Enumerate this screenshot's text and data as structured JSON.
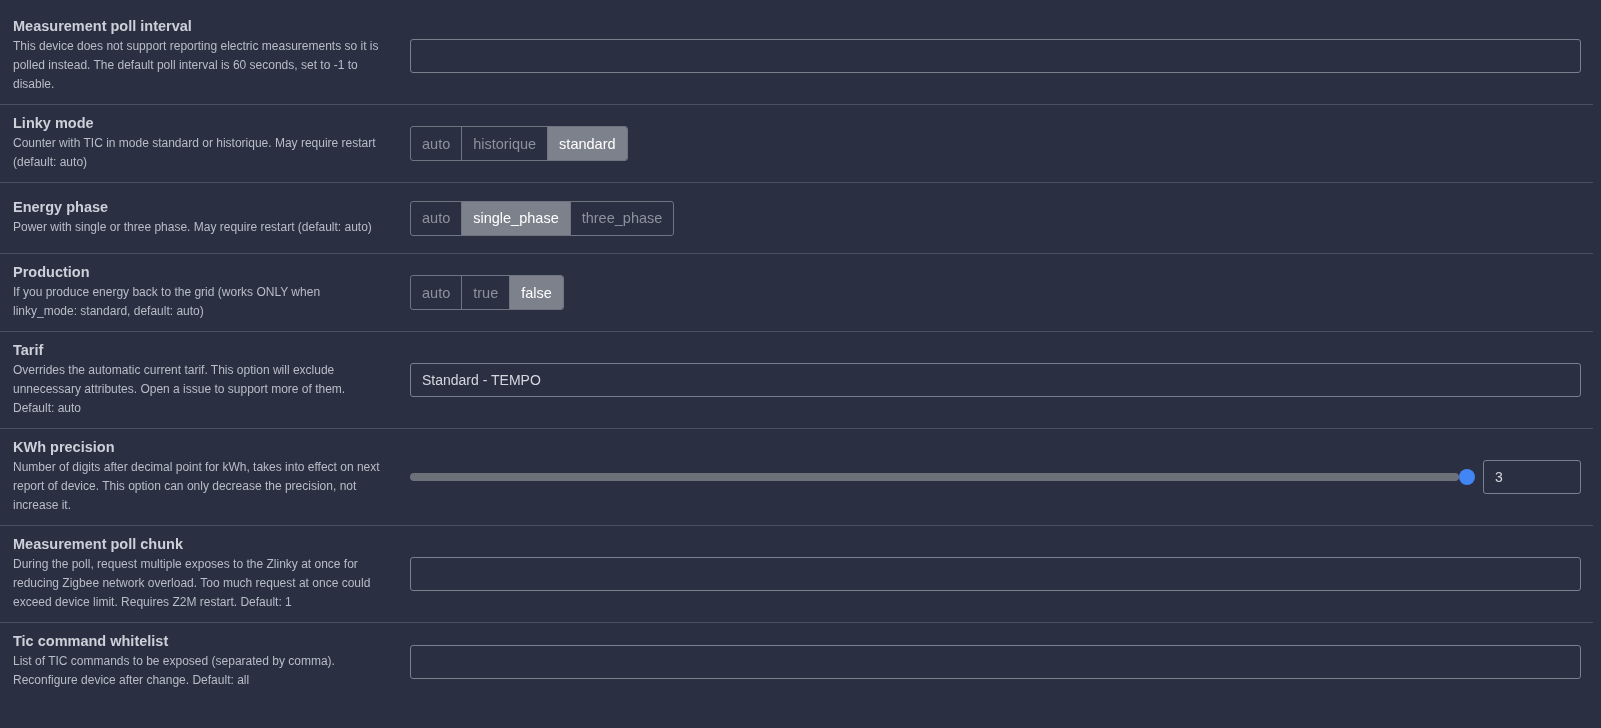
{
  "settings": [
    {
      "title": "Measurement poll interval",
      "description": "This device does not support reporting electric measurements so it is polled instead. The default poll interval is 60 seconds, set to -1 to disable.",
      "kind": "text"
    },
    {
      "title": "Linky mode",
      "description": "Counter with TIC in mode standard or historique. May require restart (default: auto)",
      "kind": "toggle",
      "options": [
        {
          "label": "auto",
          "selected": false
        },
        {
          "label": "historique",
          "selected": false
        },
        {
          "label": "standard",
          "selected": true
        }
      ]
    },
    {
      "title": "Energy phase",
      "description": "Power with single or three phase. May require restart (default: auto)",
      "kind": "toggle",
      "options": [
        {
          "label": "auto",
          "selected": false
        },
        {
          "label": "single_phase",
          "selected": true
        },
        {
          "label": "three_phase",
          "selected": false
        }
      ]
    },
    {
      "title": "Production",
      "description": "If you produce energy back to the grid (works ONLY when linky_mode: standard, default: auto)",
      "kind": "toggle",
      "options": [
        {
          "label": "auto",
          "selected": false
        },
        {
          "label": "true",
          "selected": false
        },
        {
          "label": "false",
          "selected": true
        }
      ]
    },
    {
      "title": "Tarif",
      "description": "Overrides the automatic current tarif. This option will exclude unnecessary attributes. Open a issue to support more of them. Default: auto",
      "kind": "text",
      "value": "Standard - TEMPO"
    },
    {
      "title": "KWh precision",
      "description": "Number of digits after decimal point for kWh, takes into effect on next report of device. This option can only decrease the precision, not increase it.",
      "kind": "slider",
      "level": 1.0,
      "value": "3"
    },
    {
      "title": "Measurement poll chunk",
      "description": "During the poll, request multiple exposes to the Zlinky at once for reducing Zigbee network overload. Too much request at once could exceed device limit. Requires Z2M restart. Default: 1",
      "kind": "text"
    },
    {
      "title": "Tic command whitelist",
      "description": "List of TIC commands to be exposed (separated by comma). Reconfigure device after change. Default: all",
      "kind": "text"
    }
  ]
}
